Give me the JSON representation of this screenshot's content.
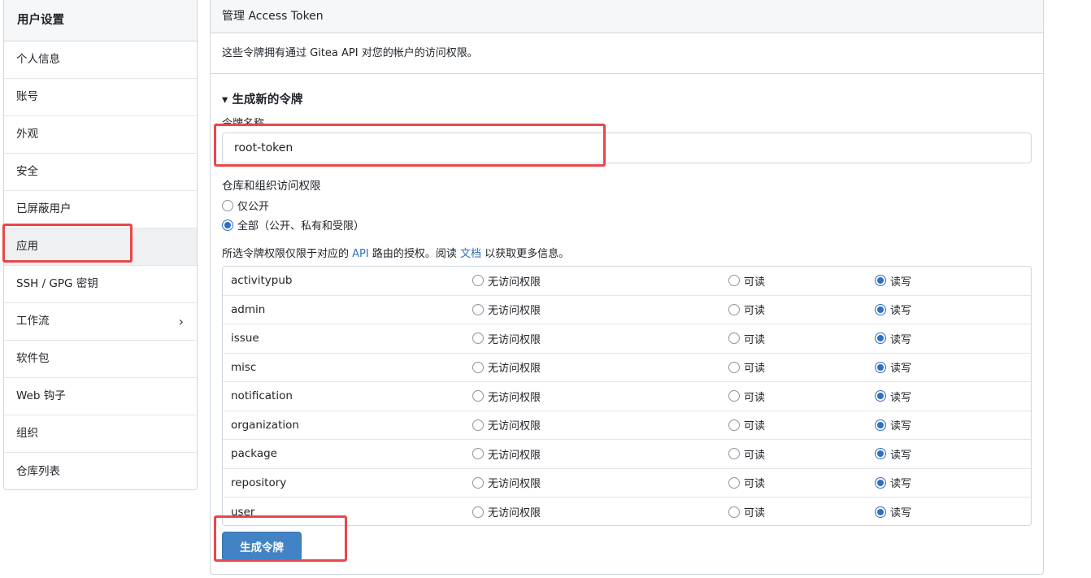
{
  "sidebar": {
    "title": "用户设置",
    "items": [
      {
        "label": "个人信息"
      },
      {
        "label": "账号"
      },
      {
        "label": "外观"
      },
      {
        "label": "安全"
      },
      {
        "label": "已屏蔽用户"
      },
      {
        "label": "应用",
        "active": true
      },
      {
        "label": "SSH / GPG 密钥"
      },
      {
        "label": "工作流",
        "has_submenu": true
      },
      {
        "label": "软件包"
      },
      {
        "label": "Web 钩子"
      },
      {
        "label": "组织"
      },
      {
        "label": "仓库列表"
      }
    ],
    "chevron_icon": "chevron-right-icon"
  },
  "panel": {
    "title": "管理 Access Token",
    "description": "这些令牌拥有通过 Gitea API 对您的帐户的访问权限。",
    "section_title": "▾ 生成新的令牌",
    "token_name_label": "令牌名称",
    "token_name_value": "root-token",
    "repo_access_label": "仓库和组织访问权限",
    "repo_access_options": [
      {
        "label": "仅公开",
        "checked": false
      },
      {
        "label": "全部（公开、私有和受限）",
        "checked": true
      }
    ],
    "perm_note": {
      "prefix": "所选令牌权限仅限于对应的 ",
      "api_link": "API",
      "middle": " 路由的授权。阅读 ",
      "doc_link": "文档",
      "suffix": " 以获取更多信息。"
    },
    "permission_options": [
      "无访问权限",
      "可读",
      "读写"
    ],
    "permissions": [
      {
        "name": "activitypub",
        "selected": "读写"
      },
      {
        "name": "admin",
        "selected": "读写"
      },
      {
        "name": "issue",
        "selected": "读写"
      },
      {
        "name": "misc",
        "selected": "读写"
      },
      {
        "name": "notification",
        "selected": "读写"
      },
      {
        "name": "organization",
        "selected": "读写"
      },
      {
        "name": "package",
        "selected": "读写"
      },
      {
        "name": "repository",
        "selected": "读写"
      },
      {
        "name": "user",
        "selected": "读写"
      }
    ],
    "generate_button": "生成令牌"
  },
  "colors": {
    "accent": "#4183c4",
    "radio_checked": "#2f6fc4",
    "highlight": "#e8474a"
  }
}
